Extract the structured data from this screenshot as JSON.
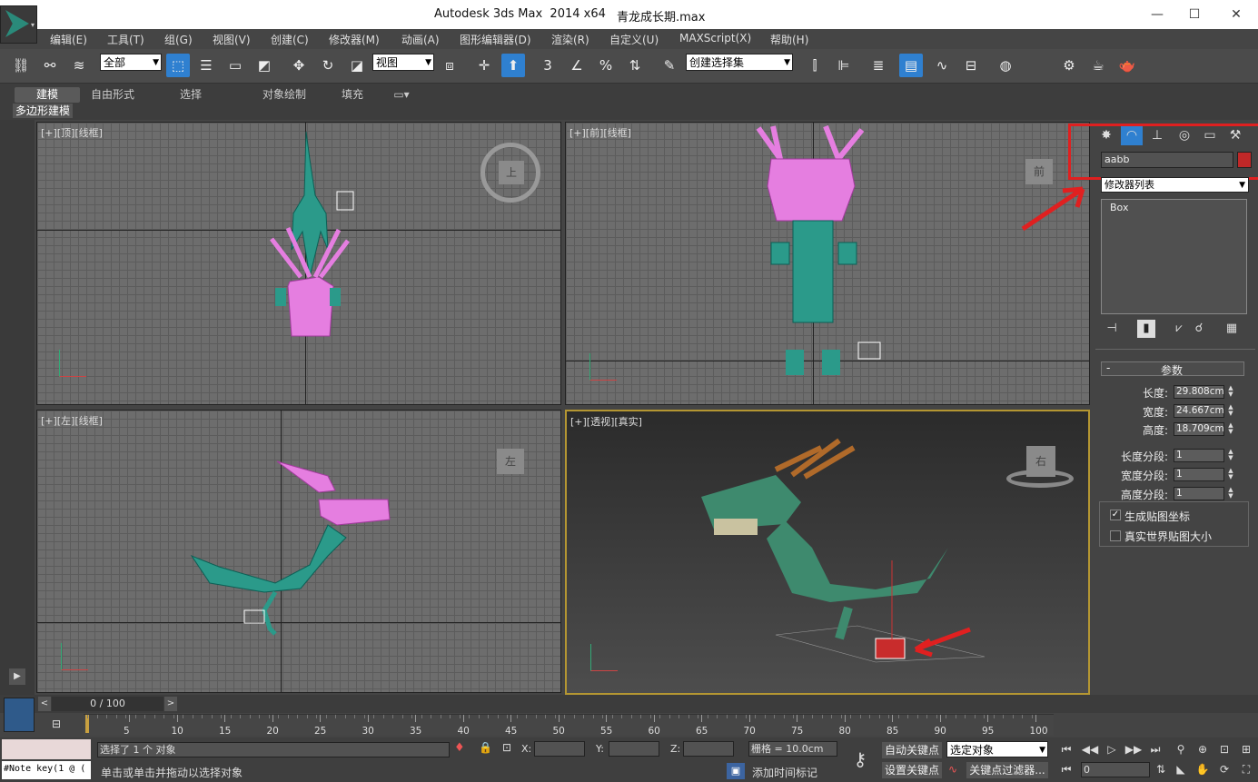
{
  "window": {
    "app_title": "Autodesk 3ds Max  2014 x64",
    "file_name": "青龙成长期.max",
    "minimize": "—",
    "maximize": "☐",
    "close": "✕"
  },
  "menu": [
    "编辑(E)",
    "工具(T)",
    "组(G)",
    "视图(V)",
    "创建(C)",
    "修改器(M)",
    "动画(A)",
    "图形编辑器(D)",
    "渲染(R)",
    "自定义(U)",
    "MAXScript(X)",
    "帮助(H)"
  ],
  "toolbar": {
    "selection_filter": "全部",
    "ref_coord": "视图",
    "named_selection": "创建选择集",
    "snap_3": "3",
    "snap_percent": "%"
  },
  "ribbon": {
    "tabs": [
      "建模",
      "自由形式",
      "选择",
      "对象绘制",
      "填充"
    ],
    "sub_label": "多边形建模"
  },
  "viewports": {
    "top": {
      "label": "[+][顶][线框]",
      "cube_label": "上"
    },
    "front": {
      "label": "[+][前][线框]",
      "cube_label": "前"
    },
    "left": {
      "label": "[+][左][线框]",
      "cube_label": "左"
    },
    "persp": {
      "label": "[+][透视][真实]",
      "cube_label": "右"
    }
  },
  "command_panel": {
    "object_name": "aabb",
    "object_color": "#c02828",
    "modifier_list": "修改器列表",
    "stack_item": "Box",
    "rollout_title": "参数",
    "rollout_toggle": "-",
    "params": [
      {
        "label": "长度:",
        "value": "29.808cm"
      },
      {
        "label": "宽度:",
        "value": "24.667cm"
      },
      {
        "label": "高度:",
        "value": "18.709cm"
      }
    ],
    "segs": [
      {
        "label": "长度分段:",
        "value": "1"
      },
      {
        "label": "宽度分段:",
        "value": "1"
      },
      {
        "label": "高度分段:",
        "value": "1"
      }
    ],
    "gen_map_coords": "生成贴图坐标",
    "real_world_map": "真实世界贴图大小"
  },
  "timeline": {
    "position": "0 / 100",
    "ticks": [
      "5",
      "10",
      "15",
      "20",
      "25",
      "30",
      "35",
      "40",
      "45",
      "50",
      "55",
      "60",
      "65",
      "70",
      "75",
      "80",
      "85",
      "90",
      "95",
      "100"
    ]
  },
  "status": {
    "maxscript_listener": "#Note key(1 @ (",
    "selection_info": "选择了 1 个 对象",
    "prompt": "单击或单击并拖动以选择对象",
    "x_label": "X:",
    "y_label": "Y:",
    "z_label": "Z:",
    "grid": "栅格 = 10.0cm",
    "add_time_tag": "添加时间标记",
    "auto_key": "自动关键点",
    "set_key": "设置关键点",
    "key_mode_select": "选定对象",
    "key_filters": "关键点过滤器...",
    "frame": "0"
  }
}
